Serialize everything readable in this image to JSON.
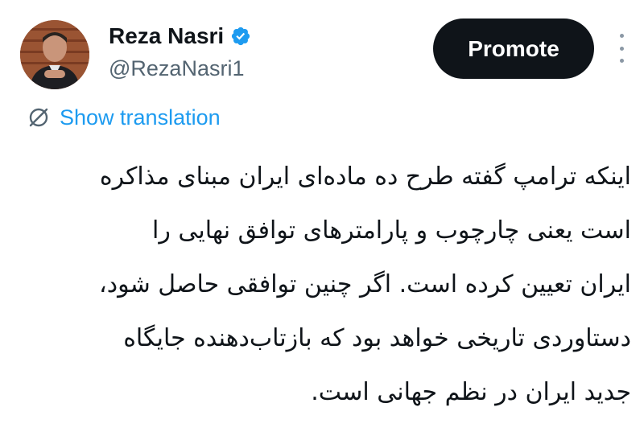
{
  "author": {
    "display_name": "Reza Nasri",
    "handle": "@RezaNasri1",
    "verified": true,
    "verified_color": "#1d9bf0"
  },
  "actions": {
    "promote_label": "Promote",
    "more_icon": "vertical-ellipsis-icon"
  },
  "translation": {
    "label": "Show translation",
    "icon": "globe-slash-icon",
    "color": "#1d9bf0"
  },
  "tweet": {
    "direction": "rtl",
    "lines": [
      "اینکه ترامپ گفته طرح ده ماده‌ای ایران مبنای مذاکره",
      "است یعنی چارچوب و پارامترهای توافق نهایی را",
      "ایران تعیین کرده است. اگر چنین توافقی حاصل شود،",
      "دستاوردی تاریخی خواهد بود که بازتاب‌دهنده جایگاه",
      "جدید ایران در نظم جهانی است."
    ]
  },
  "colors": {
    "text": "#0f1419",
    "secondary": "#536471",
    "button_bg": "#0f1419",
    "button_text": "#ffffff"
  }
}
